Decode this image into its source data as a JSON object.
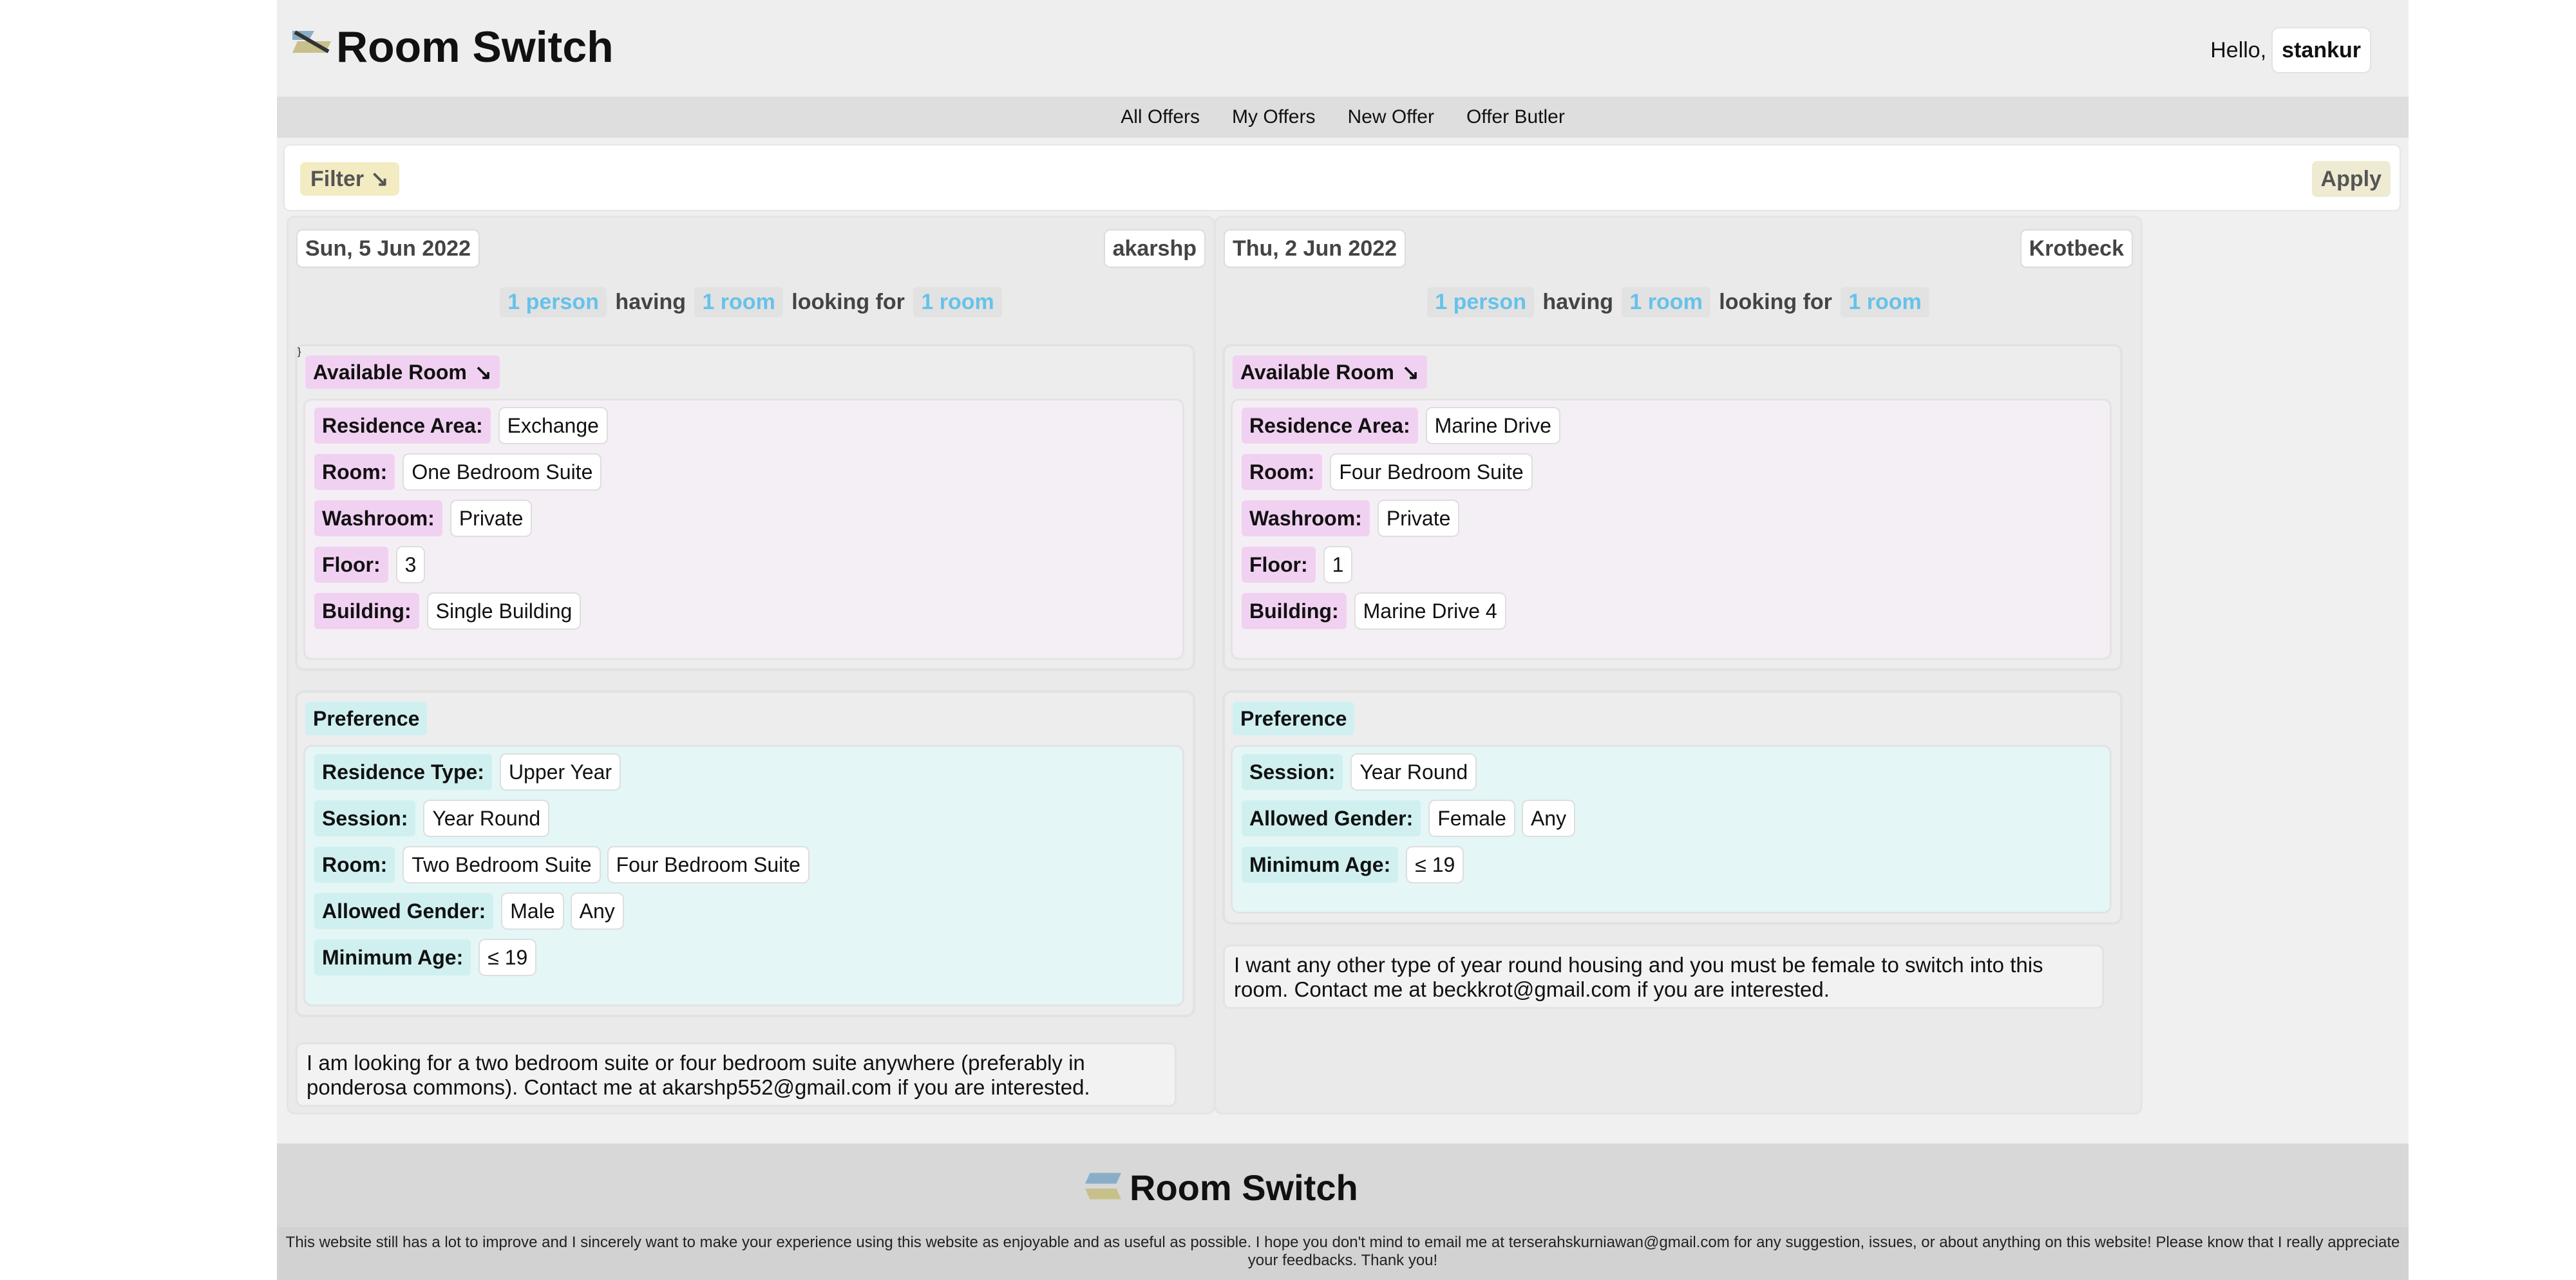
{
  "header": {
    "brand": "Room Switch",
    "greeting": "Hello,",
    "username": "stankur"
  },
  "nav": {
    "items": [
      "All Offers",
      "My Offers",
      "New Offer",
      "Offer Butler"
    ]
  },
  "filter": {
    "label": "Filter",
    "arrow": "↘",
    "apply": "Apply"
  },
  "offers": [
    {
      "date": "Sun, 5 Jun 2022",
      "user": "akarshp",
      "summary": {
        "persons": "1 person",
        "having": "having",
        "rooms_have": "1 room",
        "looking": "looking for",
        "rooms_want": "1 room"
      },
      "available": {
        "title": "Available Room",
        "arrow": "↘",
        "rows": [
          {
            "k": "Residence Area:",
            "v": [
              "Exchange"
            ]
          },
          {
            "k": "Room:",
            "v": [
              "One Bedroom Suite"
            ]
          },
          {
            "k": "Washroom:",
            "v": [
              "Private"
            ]
          },
          {
            "k": "Floor:",
            "v": [
              "3"
            ]
          },
          {
            "k": "Building:",
            "v": [
              "Single Building"
            ]
          }
        ]
      },
      "preference": {
        "title": "Preference",
        "rows": [
          {
            "k": "Residence Type:",
            "v": [
              "Upper Year"
            ]
          },
          {
            "k": "Session:",
            "v": [
              "Year Round"
            ]
          },
          {
            "k": "Room:",
            "v": [
              "Two Bedroom Suite",
              "Four Bedroom Suite"
            ]
          },
          {
            "k": "Allowed Gender:",
            "v": [
              "Male",
              "Any"
            ]
          },
          {
            "k": "Minimum Age:",
            "v": [
              "≤ 19"
            ]
          }
        ]
      },
      "description": "I am looking for a two bedroom suite or four bedroom suite anywhere (preferably in ponderosa commons). Contact me at akarshp552@gmail.com if you are interested."
    },
    {
      "date": "Thu, 2 Jun 2022",
      "user": "Krotbeck",
      "summary": {
        "persons": "1 person",
        "having": "having",
        "rooms_have": "1 room",
        "looking": "looking for",
        "rooms_want": "1 room"
      },
      "available": {
        "title": "Available Room",
        "arrow": "↘",
        "rows": [
          {
            "k": "Residence Area:",
            "v": [
              "Marine Drive"
            ]
          },
          {
            "k": "Room:",
            "v": [
              "Four Bedroom Suite"
            ]
          },
          {
            "k": "Washroom:",
            "v": [
              "Private"
            ]
          },
          {
            "k": "Floor:",
            "v": [
              "1"
            ]
          },
          {
            "k": "Building:",
            "v": [
              "Marine Drive 4"
            ]
          }
        ]
      },
      "preference": {
        "title": "Preference",
        "rows": [
          {
            "k": "Session:",
            "v": [
              "Year Round"
            ]
          },
          {
            "k": "Allowed Gender:",
            "v": [
              "Female",
              "Any"
            ]
          },
          {
            "k": "Minimum Age:",
            "v": [
              "≤ 19"
            ]
          }
        ]
      },
      "description": "I want any other type of year round housing and you must be female to switch into this room. Contact me at beckkrot@gmail.com if you are interested."
    }
  ],
  "footer": {
    "brand": "Room Switch",
    "note": "This website still has a lot to improve and I sincerely want to make your experience using this website as enjoyable and as useful as possible. I hope you don't mind to email me at terserahskurniawan@gmail.com for any suggestion, issues, or about anything on this website! Please know that I really appreciate your feedbacks. Thank you!"
  },
  "colors": {
    "accent_blue": "#66c2ea",
    "pink_tag": "#f1d1f1",
    "teal_tag": "#d0f0f0",
    "filter_yellow": "#f3ebc2"
  }
}
